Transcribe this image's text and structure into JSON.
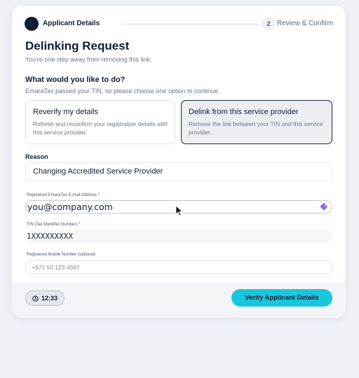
{
  "stepper": {
    "step1_label": "Applicant Details",
    "step2_number": "2",
    "step2_label": "Review & Confirm"
  },
  "page": {
    "title": "Delinking Request",
    "subtitle": "You're one step away from removing this link."
  },
  "question": {
    "title": "What would you like to do?",
    "hint": "EmaraTax passed your TIN, so please choose one option to continue."
  },
  "options": [
    {
      "title": "Reverify my details",
      "description": "Refresh and reconfirm your registration details with this service provider.",
      "selected": false
    },
    {
      "title": "Delink from this service provider",
      "description": "Remove the link between your TIN and this service provider.",
      "selected": true
    }
  ],
  "reason": {
    "label": "Reason",
    "value": "Changing Accredited Service Provider"
  },
  "email": {
    "label": "Registered EmaraTax E-mail Address *",
    "value": "you@company.com"
  },
  "tin": {
    "label": "TIN (Tax Identifier Number) *",
    "value": "1XXXXXXXXX"
  },
  "mobile": {
    "label": "Registered Mobile Number (optional)",
    "placeholder": "+971 50 123 4567"
  },
  "footer": {
    "timer": "12:33",
    "verify_label": "Verify Applicant Details"
  },
  "colors": {
    "accent": "#19c7dd",
    "primary_dark": "#0f1e35",
    "page_background": "#eef1f6"
  },
  "icons": [
    "clock-icon",
    "autofill-icon",
    "mouse-cursor-icon"
  ]
}
